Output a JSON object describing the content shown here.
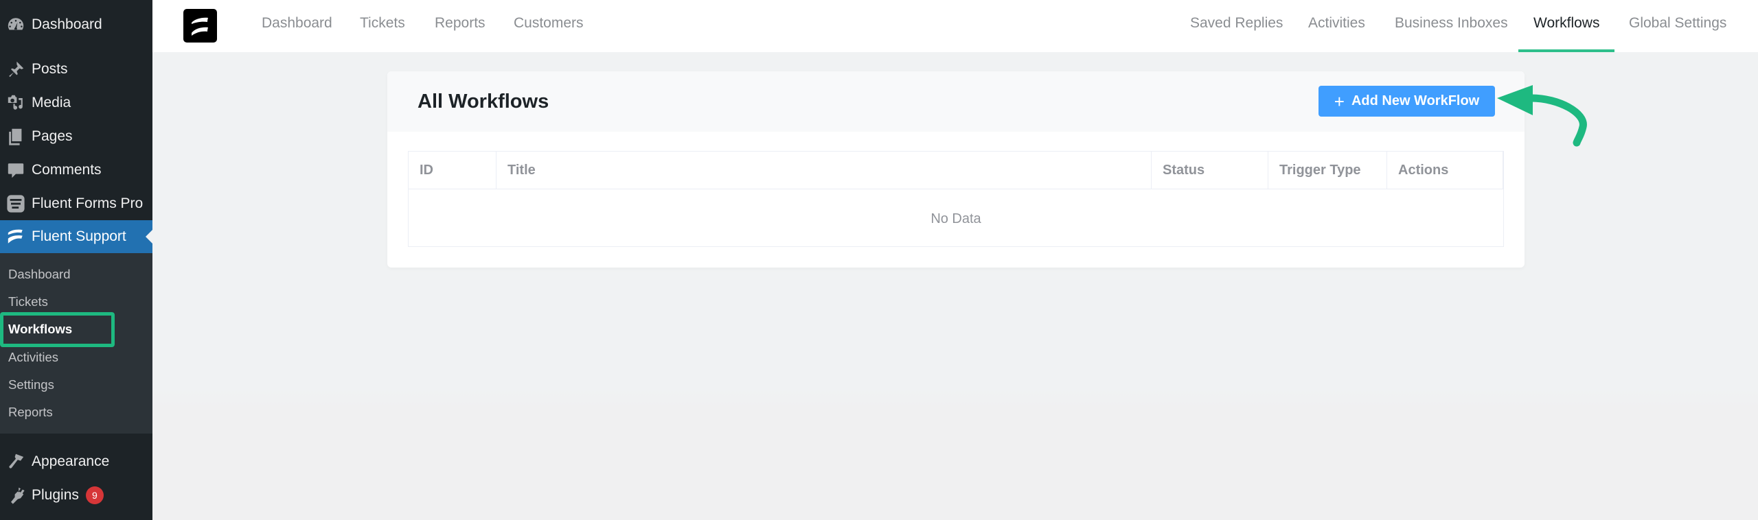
{
  "wp_sidebar": {
    "items": [
      {
        "label": "Dashboard",
        "icon": "dashboard-icon"
      },
      {
        "label": "Posts",
        "icon": "pin-icon"
      },
      {
        "label": "Media",
        "icon": "media-icon"
      },
      {
        "label": "Pages",
        "icon": "pages-icon"
      },
      {
        "label": "Comments",
        "icon": "comment-icon"
      },
      {
        "label": "Fluent Forms Pro",
        "icon": "fluent-forms-icon"
      },
      {
        "label": "Fluent Support",
        "icon": "fluent-support-icon",
        "active": true
      },
      {
        "label": "Appearance",
        "icon": "paintbrush-icon"
      },
      {
        "label": "Plugins",
        "icon": "plug-icon",
        "badge": "9"
      }
    ],
    "submenu": [
      {
        "label": "Dashboard"
      },
      {
        "label": "Tickets"
      },
      {
        "label": "Workflows",
        "current": true
      },
      {
        "label": "Activities"
      },
      {
        "label": "Settings"
      },
      {
        "label": "Reports"
      }
    ]
  },
  "topnav": {
    "left": [
      "Dashboard",
      "Tickets",
      "Reports",
      "Customers"
    ],
    "right": [
      "Saved Replies",
      "Activities",
      "Business Inboxes",
      "Workflows",
      "Global Settings"
    ],
    "active": "Workflows"
  },
  "page": {
    "title": "All Workflows",
    "add_button": "Add New WorkFlow",
    "add_button_icon": "+",
    "table": {
      "columns": [
        "ID",
        "Title",
        "Status",
        "Trigger Type",
        "Actions"
      ],
      "rows": [],
      "empty_text": "No Data"
    }
  },
  "colors": {
    "wp_sidebar_bg": "#1d2327",
    "wp_active": "#2271b1",
    "accent_green": "#2ebf8b",
    "annotation_green": "#1eb980",
    "button_blue": "#409eff",
    "badge_red": "#d63638"
  }
}
